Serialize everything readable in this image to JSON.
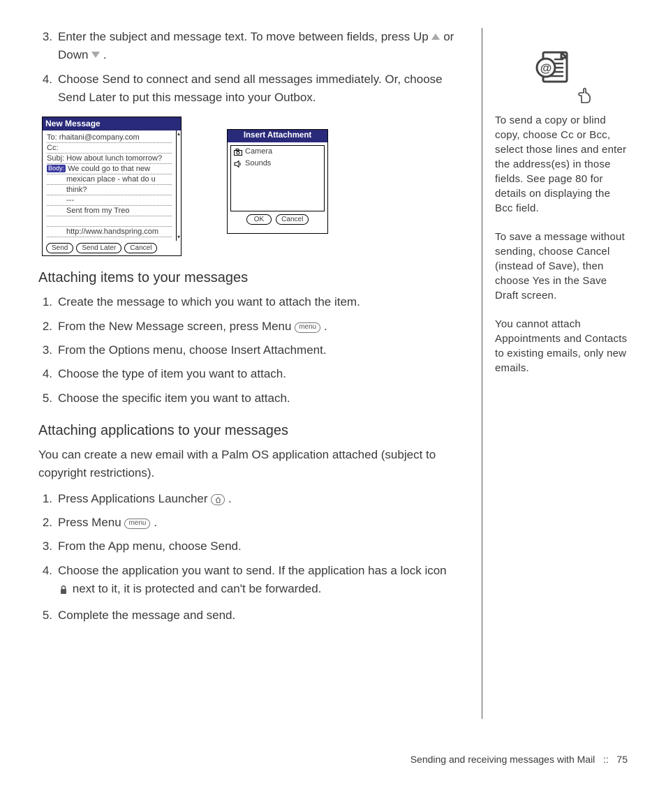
{
  "main": {
    "step3_a": "Enter the subject and message text. To move between fields, press Up ",
    "step3_b": " or Down ",
    "step3_c": " .",
    "step4": "Choose Send to connect and send all messages immediately. Or, choose Send Later to put this message into your Outbox.",
    "h_attach_items": "Attaching items to your messages",
    "attach_items": {
      "s1": "Create the message to which you want to attach the item.",
      "s2_a": "From the New Message screen, press Menu ",
      "s2_b": " .",
      "s3": "From the Options menu, choose Insert Attachment.",
      "s4": "Choose the type of item you want to attach.",
      "s5": "Choose the specific item you want to attach."
    },
    "h_attach_apps": "Attaching applications to your messages",
    "attach_apps_intro": "You can create a new email with a Palm OS application attached (subject to copyright restrictions).",
    "attach_apps": {
      "s1_a": "Press Applications Launcher ",
      "s1_b": " .",
      "s2_a": "Press Menu ",
      "s2_b": " .",
      "s3": "From the App menu, choose Send.",
      "s4_a": "Choose the application you want to send. If the application has a lock icon ",
      "s4_b": " next to it, it is protected and can't be forwarded.",
      "s5": "Complete the message and send."
    },
    "menu_label": "menu"
  },
  "shot1": {
    "title": "New Message",
    "to_label": "To:",
    "to_value": "rhaitani@company.com",
    "cc_label": "Cc:",
    "subj_label": "Subj:",
    "subj_value": "How about lunch tomorrow?",
    "body_tag": "Body:",
    "body_l1": "We could go to that new",
    "body_l2": "mexican place - what do u",
    "body_l3": "think?",
    "sig": "Sent from my Treo",
    "url": "http://www.handspring.com",
    "dash": "---",
    "btn_send": "Send",
    "btn_later": "Send Later",
    "btn_cancel": "Cancel"
  },
  "shot2": {
    "title": "Insert Attachment",
    "item1": "Camera",
    "item2": "Sounds",
    "btn_ok": "OK",
    "btn_cancel": "Cancel"
  },
  "sidebar": {
    "tip1": "To send a copy or blind copy, choose Cc or Bcc, select those lines and enter the address(es) in those fields. See page 80 for details on displaying the Bcc field.",
    "tip2": "To save a message without sending, choose Cancel (instead of Save), then choose Yes in the Save Draft screen.",
    "tip3": "You cannot attach Appointments and Contacts to existing emails, only new emails."
  },
  "footer": {
    "text": "Sending and receiving messages with Mail",
    "sep": "::",
    "page": "75"
  },
  "nums": {
    "n1": "1.",
    "n2": "2.",
    "n3": "3.",
    "n4": "4.",
    "n5": "5."
  }
}
